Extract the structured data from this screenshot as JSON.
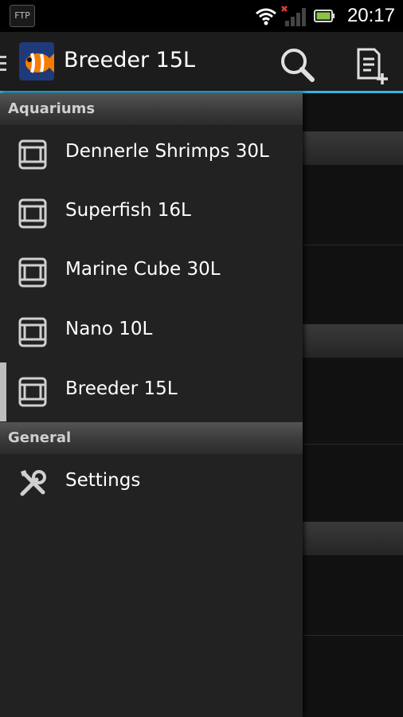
{
  "status_bar": {
    "ftp_label": "FTP",
    "time": "20:17"
  },
  "action_bar": {
    "title": "Breeder 15L",
    "search_icon": "search-icon",
    "add_note_icon": "add-note-icon",
    "accent": "#33b5e5"
  },
  "drawer": {
    "sections": [
      {
        "title": "Aquariums",
        "items": [
          {
            "label": "Dennerle Shrimps 30L",
            "icon": "aquarium-icon"
          },
          {
            "label": "Superfish 16L",
            "icon": "aquarium-icon"
          },
          {
            "label": "Marine Cube 30L",
            "icon": "aquarium-icon"
          },
          {
            "label": "Nano 10L",
            "icon": "aquarium-icon"
          },
          {
            "label": "Breeder 15L",
            "icon": "aquarium-icon",
            "selected": true
          }
        ]
      },
      {
        "title": "General",
        "items": [
          {
            "label": "Settings",
            "icon": "settings-icon"
          }
        ]
      }
    ]
  }
}
